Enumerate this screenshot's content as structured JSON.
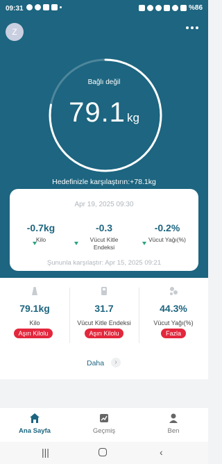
{
  "statusbar": {
    "time": "09:31",
    "battery": "%86"
  },
  "header": {
    "avatar_letter": "Z"
  },
  "scale": {
    "status": "Bağlı değil",
    "weight_value": "79.1",
    "weight_unit": "kg",
    "ring_progress": 0.78
  },
  "goal_text": "Hedefinizle karşılaştırın:+78.1kg",
  "summary_card": {
    "date": "Apr 19, 2025 09:30",
    "deltas": [
      {
        "value": "-0.7kg",
        "label": "Kilo"
      },
      {
        "value": "-0.3",
        "label": "Vücut Kitle Endeksi"
      },
      {
        "value": "-0.2%",
        "label": "Vücut Yağı(%)"
      }
    ],
    "compare_text": "Şununla karşılaştır: Apr 15, 2025 09:21"
  },
  "metrics": [
    {
      "value": "79.1kg",
      "label": "Kilo",
      "badge": "Aşırı Kilolu",
      "icon": "scale-icon"
    },
    {
      "value": "31.7",
      "label": "Vücut Kitle Endeksi",
      "badge": "Aşırı Kilolu",
      "icon": "bmi-icon"
    },
    {
      "value": "44.3%",
      "label": "Vücut Yağı(%)",
      "badge": "Fazla",
      "icon": "body-fat-icon"
    }
  ],
  "more_label": "Daha",
  "nav": [
    {
      "label": "Ana Sayfa",
      "icon": "home-icon"
    },
    {
      "label": "Geçmiş",
      "icon": "chart-icon"
    },
    {
      "label": "Ben",
      "icon": "person-icon"
    }
  ],
  "colors": {
    "primary": "#1d6580",
    "badge": "#e3273c",
    "arrow": "#2aa380"
  }
}
